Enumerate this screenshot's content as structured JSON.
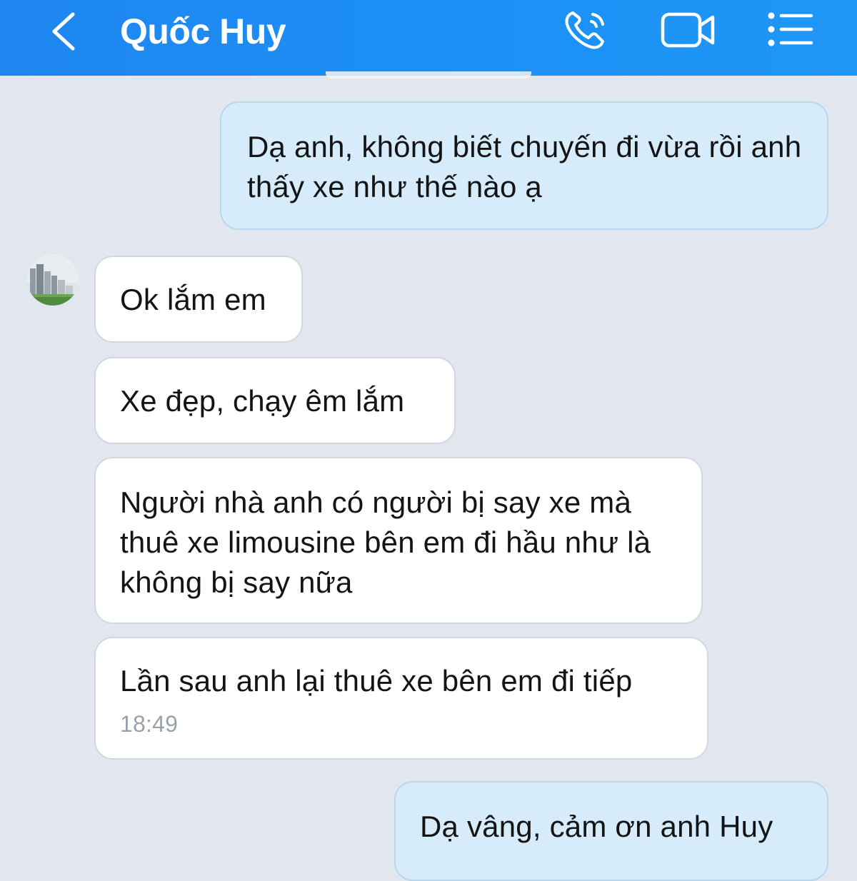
{
  "header": {
    "contact_name": "Quốc Huy",
    "icons": {
      "back": "chevron-left-icon",
      "call": "phone-icon",
      "video": "video-camera-icon",
      "menu": "list-menu-icon"
    },
    "background": "#1f8cf3"
  },
  "messages": [
    {
      "direction": "outgoing",
      "text": "Dạ anh, không biết chuyến đi vừa rồi anh thấy xe như thế nào ạ"
    },
    {
      "direction": "incoming",
      "text": "Ok lắm em"
    },
    {
      "direction": "incoming",
      "text": "Xe đẹp, chạy êm lắm"
    },
    {
      "direction": "incoming",
      "text": "Người nhà anh có người bị say xe mà thuê xe limousine bên em đi hầu như là không bị say nữa"
    },
    {
      "direction": "incoming",
      "text": "Lần sau anh lại thuê xe bên em đi tiếp",
      "time": "18:49"
    },
    {
      "direction": "outgoing",
      "text": "Dạ vâng, cảm ơn anh Huy"
    }
  ],
  "colors": {
    "chat_background": "#e2e7ef",
    "outgoing_bubble": "#d6ecfb",
    "incoming_bubble": "#ffffff"
  }
}
